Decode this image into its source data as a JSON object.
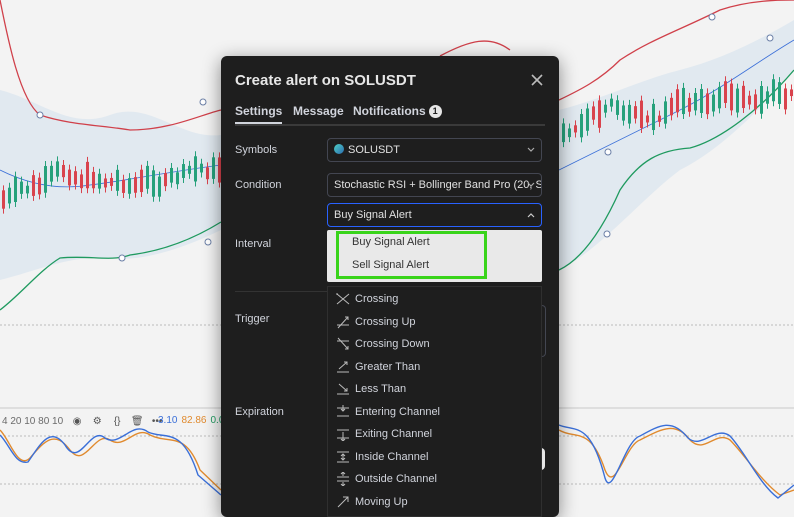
{
  "dialog": {
    "title": "Create alert on SOLUSDT",
    "tabs": [
      {
        "label": "Settings",
        "active": true
      },
      {
        "label": "Message",
        "active": false
      },
      {
        "label": "Notifications",
        "badge": "1",
        "active": false
      }
    ],
    "rows": {
      "symbols_label": "Symbols",
      "symbol_value": "SOLUSDT",
      "condition_label": "Condition",
      "condition_value": "Stochastic RSI + Bollinger Band Pro (20, S...",
      "condition_sub_value": "Buy Signal Alert",
      "interval_label": "Interval",
      "trigger_label": "Trigger",
      "expiration_label": "Expiration"
    },
    "signal_options": [
      "Buy Signal Alert",
      "Sell Signal Alert"
    ],
    "condition_options": [
      {
        "label": "Crossing",
        "icon": "crossing-icon"
      },
      {
        "label": "Crossing Up",
        "icon": "crossing-up-icon"
      },
      {
        "label": "Crossing Down",
        "icon": "crossing-down-icon"
      },
      {
        "label": "Greater Than",
        "icon": "greater-than-icon"
      },
      {
        "label": "Less Than",
        "icon": "less-than-icon"
      },
      {
        "label": "Entering Channel",
        "icon": "entering-channel-icon"
      },
      {
        "label": "Exiting Channel",
        "icon": "exiting-channel-icon"
      },
      {
        "label": "Inside Channel",
        "icon": "inside-channel-icon"
      },
      {
        "label": "Outside Channel",
        "icon": "outside-channel-icon"
      },
      {
        "label": "Moving Up",
        "icon": "moving-up-icon"
      }
    ]
  },
  "indicator_strip": {
    "params": "4 20 10 80 10",
    "values": [
      "3.10",
      "82.86",
      "0.0"
    ]
  },
  "colors": {
    "accent": "#2962ff",
    "highlight_box": "#39d41a",
    "upper_band": "#d0404a",
    "lower_band": "#1f9a5f",
    "stoch_k": "#3a6fd8",
    "stoch_d": "#e08a2e"
  }
}
